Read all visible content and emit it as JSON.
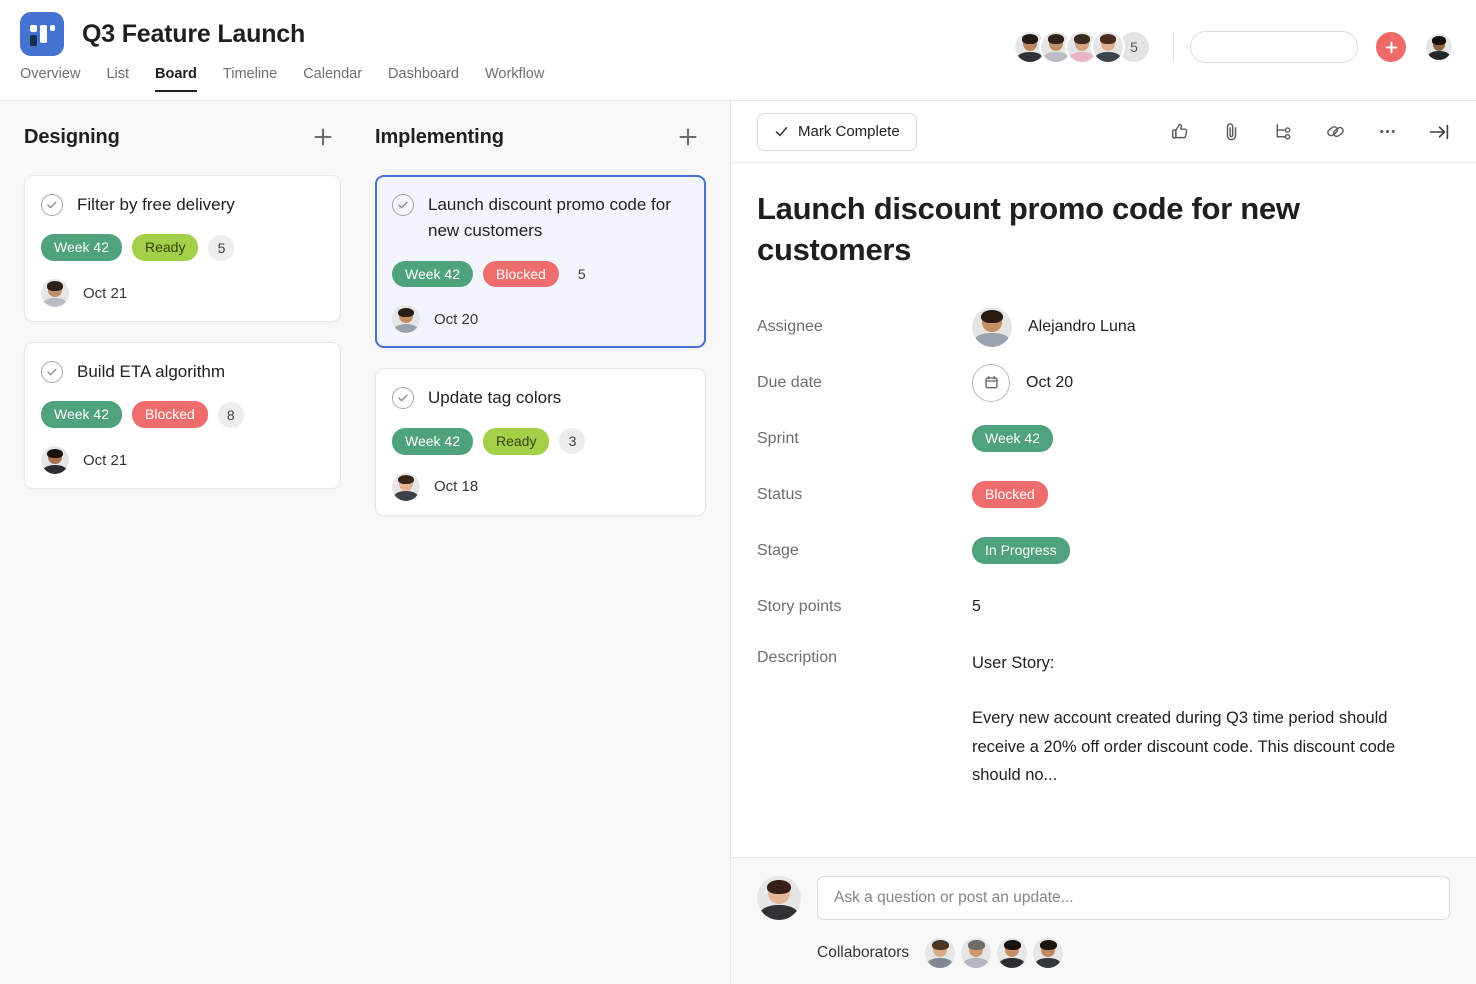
{
  "header": {
    "app_icon_name": "board-app-icon",
    "project_title": "Q3 Feature Launch",
    "tabs": [
      {
        "label": "Overview",
        "active": false
      },
      {
        "label": "List",
        "active": false
      },
      {
        "label": "Board",
        "active": true
      },
      {
        "label": "Timeline",
        "active": false
      },
      {
        "label": "Calendar",
        "active": false
      },
      {
        "label": "Dashboard",
        "active": false
      },
      {
        "label": "Workflow",
        "active": false
      }
    ],
    "members_overflow_count": "5",
    "search": {
      "value": "",
      "placeholder": ""
    },
    "add_button_label": "+"
  },
  "board": {
    "columns": [
      {
        "title": "Designing",
        "add_label": "+",
        "cards": [
          {
            "title": "Filter by free delivery",
            "tags": [
              {
                "label": "Week 42",
                "style": "pill-week"
              },
              {
                "label": "Ready",
                "style": "pill-ready"
              }
            ],
            "count": "5",
            "date": "Oct 21",
            "selected": false
          },
          {
            "title": "Build ETA algorithm",
            "tags": [
              {
                "label": "Week 42",
                "style": "pill-week"
              },
              {
                "label": "Blocked",
                "style": "pill-blocked"
              }
            ],
            "count": "8",
            "date": "Oct 21",
            "selected": false
          }
        ]
      },
      {
        "title": "Implementing",
        "add_label": "+",
        "cards": [
          {
            "title": "Launch discount promo code for new customers",
            "tags": [
              {
                "label": "Week 42",
                "style": "pill-week"
              },
              {
                "label": "Blocked",
                "style": "pill-blocked"
              }
            ],
            "count": "5",
            "date": "Oct 20",
            "selected": true
          },
          {
            "title": "Update tag colors",
            "tags": [
              {
                "label": "Week 42",
                "style": "pill-week"
              },
              {
                "label": "Ready",
                "style": "pill-ready"
              }
            ],
            "count": "3",
            "date": "Oct 18",
            "selected": false
          }
        ]
      }
    ]
  },
  "detail": {
    "mark_complete_label": "Mark Complete",
    "toolbar_icons": [
      "like-icon",
      "attachment-icon",
      "subtask-icon",
      "link-icon",
      "more-options-icon",
      "collapse-panel-icon"
    ],
    "task_title": "Launch discount promo code for new customers",
    "fields": {
      "assignee_label": "Assignee",
      "assignee_value": "Alejandro Luna",
      "due_date_label": "Due date",
      "due_date_value": "Oct 20",
      "sprint_label": "Sprint",
      "sprint_value": "Week 42",
      "status_label": "Status",
      "status_value": "Blocked",
      "stage_label": "Stage",
      "stage_value": "In Progress",
      "story_points_label": "Story points",
      "story_points_value": "5",
      "description_label": "Description",
      "description_heading": "User Story:",
      "description_body": "Every new account created during Q3 time period should receive a 20% off order discount code. This discount code should no..."
    },
    "comment_placeholder": "Ask a question or post an update...",
    "collaborators_label": "Collaborators"
  },
  "colors": {
    "accent_blue": "#4573d2",
    "pill_green": "#4fa37c",
    "pill_lime": "#a4cf48",
    "pill_red": "#ef6d6d",
    "add_button_red": "#f06a6a",
    "board_bg": "#f9f8f8"
  }
}
